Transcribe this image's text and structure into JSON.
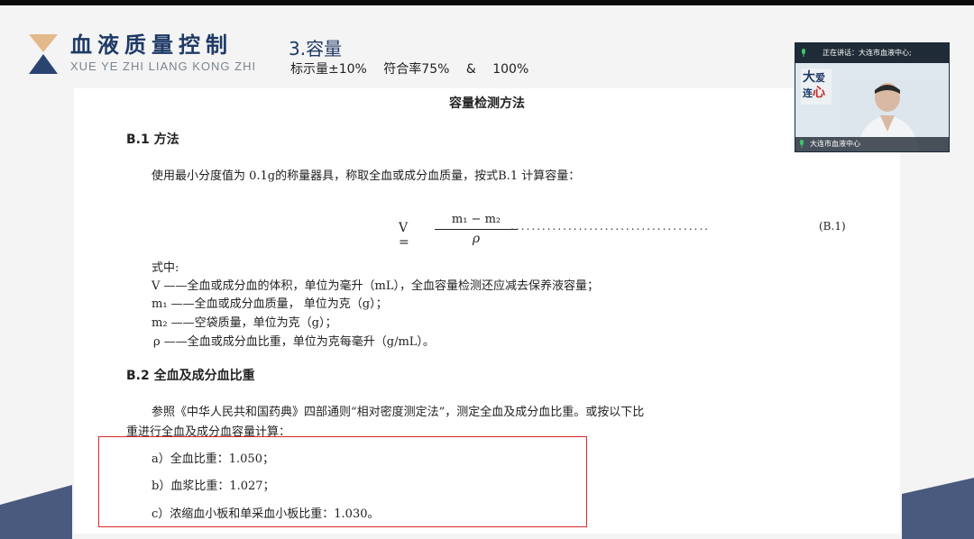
{
  "header": {
    "brand_cn": "血液质量控制",
    "brand_pinyin": "XUE YE ZHI LIANG KONG ZHI",
    "section_title": "3.容量",
    "section_sub": "标示量±10%   符合率75%  & 100%"
  },
  "document": {
    "title": "容量检测方法",
    "b1_heading": "B.1   方法",
    "b1_text": "使用最小分度值为 0.1g的称量器具，称取全血或成分血质量，按式B.1 计算容量：",
    "formula": {
      "lhs": "V =",
      "numerator": "m₁ − m₂",
      "denominator": "ρ",
      "dots": "......................................",
      "eq_no": "(B.1)"
    },
    "where_label": "式中:",
    "where_items": [
      "V ——全血或成分血的体积，单位为毫升（mL），全血容量检测还应减去保养液容量；",
      "m₁ ——全血或成分血质量，  单位为克（g）；",
      "m₂ ——空袋质量，单位为克（g）；",
      "ρ ——全血或成分血比重，单位为克每毫升（g/mL）。"
    ],
    "b2_heading": "B.2   全血及成分血比重",
    "b2_text_line1": "参照《中华人民共和国药典》四部通则“相对密度测定法”，测定全血及成分血比重。或按以下比",
    "b2_text_line2": "重进行全血及成分血容量计算：",
    "list": [
      "a）全血比重：1.050；",
      "b）血浆比重：1.027；",
      "c）浓缩血小板和单采血小板比重：1.030。"
    ]
  },
  "video": {
    "top_label": "正在讲话：大连市血液中心;",
    "bottom_label": "大连市血液中心",
    "poster_text_1": "大",
    "poster_text_2": "爱",
    "poster_text_3": "连",
    "poster_text_4": "心"
  },
  "colors": {
    "brand": "#1e3a66",
    "logo_gold": "#e3b98a",
    "highlight": "#d62a2a",
    "deco": "#4a5a7e"
  }
}
